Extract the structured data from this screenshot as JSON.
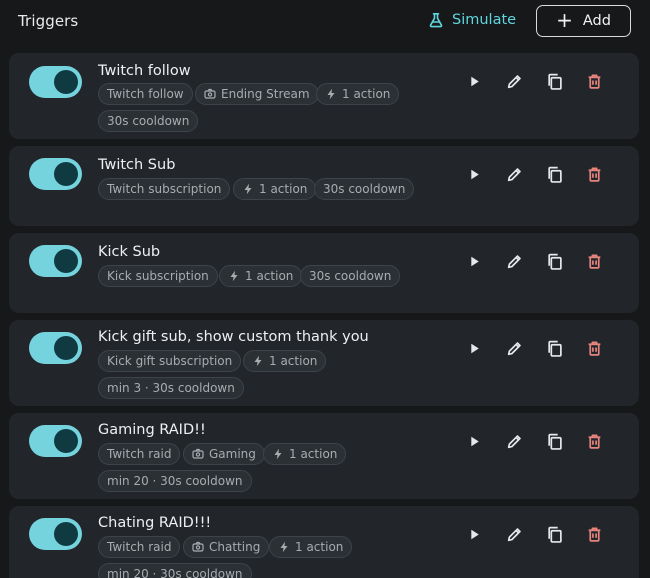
{
  "header": {
    "title": "Triggers",
    "simulate_label": "Simulate",
    "add_label": "Add"
  },
  "colors": {
    "accent": "#5fd6de",
    "toggle_on": "#75d3de",
    "delete": "#e8847e",
    "card_bg": "#22262a",
    "page_bg": "#16181a"
  },
  "triggers": [
    {
      "name": "Twitch follow",
      "enabled": true,
      "chips": [
        {
          "icon": "none",
          "label": "Twitch follow"
        },
        {
          "icon": "scene-icon",
          "label": "Ending Stream"
        },
        {
          "icon": "bolt-icon",
          "label": "1 action"
        },
        {
          "icon": "none",
          "label": "30s cooldown"
        }
      ]
    },
    {
      "name": "Twitch Sub",
      "enabled": true,
      "chips": [
        {
          "icon": "none",
          "label": "Twitch subscription"
        },
        {
          "icon": "bolt-icon",
          "label": "1 action"
        },
        {
          "icon": "none",
          "label": "30s cooldown"
        }
      ]
    },
    {
      "name": "Kick Sub",
      "enabled": true,
      "chips": [
        {
          "icon": "none",
          "label": "Kick subscription"
        },
        {
          "icon": "bolt-icon",
          "label": "1 action"
        },
        {
          "icon": "none",
          "label": "30s cooldown"
        }
      ]
    },
    {
      "name": "Kick gift sub, show custom thank you",
      "enabled": true,
      "chips": [
        {
          "icon": "none",
          "label": "Kick gift subscription"
        },
        {
          "icon": "bolt-icon",
          "label": "1 action"
        },
        {
          "icon": "none",
          "label": "min 3 · 30s cooldown"
        }
      ]
    },
    {
      "name": "Gaming RAID!!",
      "enabled": true,
      "chips": [
        {
          "icon": "none",
          "label": "Twitch raid"
        },
        {
          "icon": "scene-icon",
          "label": "Gaming"
        },
        {
          "icon": "bolt-icon",
          "label": "1 action"
        },
        {
          "icon": "none",
          "label": "min 20 · 30s cooldown"
        }
      ]
    },
    {
      "name": "Chating RAID!!!",
      "enabled": true,
      "chips": [
        {
          "icon": "none",
          "label": "Twitch raid"
        },
        {
          "icon": "scene-icon",
          "label": "Chatting"
        },
        {
          "icon": "bolt-icon",
          "label": "1 action"
        },
        {
          "icon": "none",
          "label": "min 20 · 30s cooldown"
        }
      ]
    }
  ],
  "row_actions": [
    "play-icon",
    "edit-icon",
    "copy-icon",
    "delete-icon"
  ]
}
